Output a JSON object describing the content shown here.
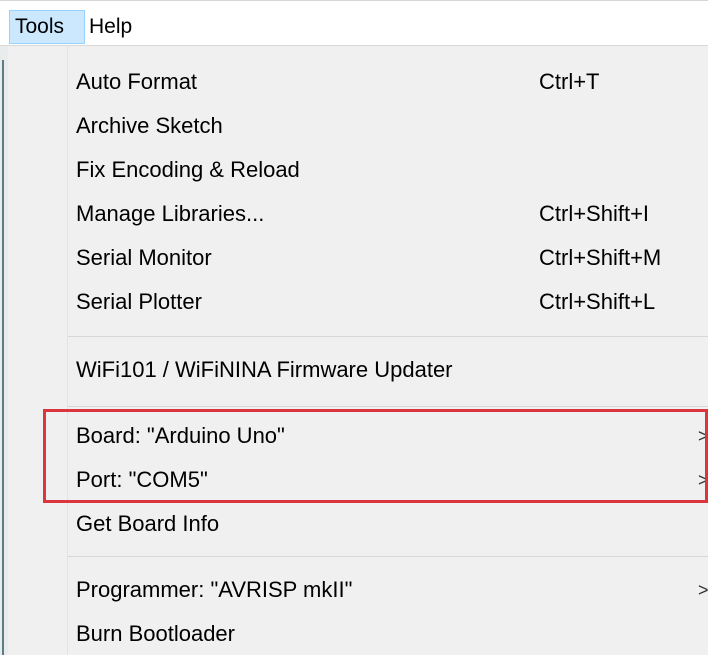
{
  "menubar": {
    "tools_label": "Tools",
    "help_label": "Help"
  },
  "menu": {
    "items": [
      {
        "label": "Auto Format",
        "shortcut": "Ctrl+T"
      },
      {
        "label": "Archive Sketch",
        "shortcut": ""
      },
      {
        "label": "Fix Encoding & Reload",
        "shortcut": ""
      },
      {
        "label": "Manage Libraries...",
        "shortcut": "Ctrl+Shift+I"
      },
      {
        "label": "Serial Monitor",
        "shortcut": "Ctrl+Shift+M"
      },
      {
        "label": "Serial Plotter",
        "shortcut": "Ctrl+Shift+L"
      },
      {
        "label": "WiFi101 / WiFiNINA Firmware Updater",
        "shortcut": ""
      },
      {
        "label": "Board: \"Arduino Uno\"",
        "submenu_arrow": ">"
      },
      {
        "label": "Port: \"COM5\"",
        "submenu_arrow": ">"
      },
      {
        "label": "Get Board Info",
        "shortcut": ""
      },
      {
        "label": "Programmer: \"AVRISP mkII\"",
        "submenu_arrow": ">"
      },
      {
        "label": "Burn Bootloader",
        "shortcut": ""
      }
    ]
  },
  "colors": {
    "menu_background": "#f0f0f0",
    "active_menubar_item": "#cce8ff",
    "annotation_highlight": "#d9363e"
  }
}
